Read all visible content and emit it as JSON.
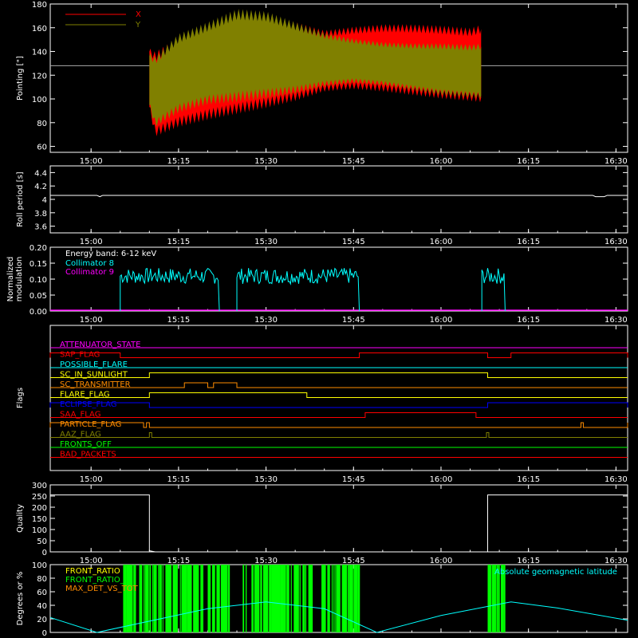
{
  "colors": {
    "background": "#000000",
    "axes": "#ffffff",
    "x_series": "#ff0000",
    "y_series": "#808000",
    "collimator8": "#00ffff",
    "collimator9": "#ff00ff",
    "green": "#00ff00",
    "orange": "#ff8c00",
    "cyan": "#00ffff"
  },
  "chart_data": [
    {
      "type": "area",
      "id": "pointing",
      "ylabel": "Pointing [\"]",
      "ylim": [
        55,
        180
      ],
      "yticks": [
        60,
        80,
        100,
        120,
        140,
        160,
        180
      ],
      "xlim": [
        "14:53",
        "16:32"
      ],
      "xticks": [
        "15:00",
        "15:15",
        "15:30",
        "15:45",
        "16:00",
        "16:15",
        "16:30"
      ],
      "reference_line": 128,
      "legend": {
        "position": "top-left",
        "entries": [
          "X",
          "Y"
        ]
      },
      "series": [
        {
          "name": "X",
          "envelope": [
            {
              "t": "15:10",
              "min": 90,
              "max": 143
            },
            {
              "t": "15:11",
              "min": 68,
              "max": 140
            },
            {
              "t": "15:15",
              "min": 76,
              "max": 152
            },
            {
              "t": "15:20",
              "min": 82,
              "max": 162
            },
            {
              "t": "15:25",
              "min": 87,
              "max": 168
            },
            {
              "t": "15:30",
              "min": 92,
              "max": 170
            },
            {
              "t": "15:35",
              "min": 98,
              "max": 165
            },
            {
              "t": "15:40",
              "min": 106,
              "max": 158
            },
            {
              "t": "15:45",
              "min": 108,
              "max": 161
            },
            {
              "t": "15:50",
              "min": 106,
              "max": 163
            },
            {
              "t": "15:55",
              "min": 103,
              "max": 163
            },
            {
              "t": "16:00",
              "min": 100,
              "max": 162
            },
            {
              "t": "16:05",
              "min": 98,
              "max": 160
            },
            {
              "t": "16:07",
              "min": 97,
              "max": 163
            }
          ]
        },
        {
          "name": "Y",
          "envelope": [
            {
              "t": "15:10",
              "min": 92,
              "max": 139
            },
            {
              "t": "15:11",
              "min": 76,
              "max": 136
            },
            {
              "t": "15:15",
              "min": 88,
              "max": 155
            },
            {
              "t": "15:20",
              "min": 95,
              "max": 165
            },
            {
              "t": "15:25",
              "min": 97,
              "max": 176
            },
            {
              "t": "15:30",
              "min": 100,
              "max": 174
            },
            {
              "t": "15:35",
              "min": 104,
              "max": 165
            },
            {
              "t": "15:40",
              "min": 110,
              "max": 156
            },
            {
              "t": "15:45",
              "min": 113,
              "max": 151
            },
            {
              "t": "15:50",
              "min": 111,
              "max": 148
            },
            {
              "t": "15:55",
              "min": 107,
              "max": 147
            },
            {
              "t": "16:00",
              "min": 103,
              "max": 147
            },
            {
              "t": "16:05",
              "min": 101,
              "max": 146
            },
            {
              "t": "16:07",
              "min": 100,
              "max": 147
            }
          ]
        }
      ]
    },
    {
      "type": "line",
      "id": "roll",
      "ylabel": "Roll period [s]",
      "ylim": [
        3.5,
        4.5
      ],
      "yticks": [
        3.6,
        3.8,
        4.0,
        4.2,
        4.4
      ],
      "xticks": [
        "15:00",
        "15:15",
        "15:30",
        "15:45",
        "16:00",
        "16:15",
        "16:30"
      ],
      "series": [
        {
          "name": "",
          "points": [
            {
              "t": "14:53",
              "v": 4.06
            },
            {
              "t": "15:01",
              "v": 4.06
            },
            {
              "t": "15:01.5",
              "v": 4.04
            },
            {
              "t": "15:02",
              "v": 4.06
            },
            {
              "t": "16:26",
              "v": 4.06
            },
            {
              "t": "16:26.5",
              "v": 4.04
            },
            {
              "t": "16:28",
              "v": 4.04
            },
            {
              "t": "16:28.5",
              "v": 4.06
            },
            {
              "t": "16:32",
              "v": 4.06
            }
          ]
        }
      ]
    },
    {
      "type": "line",
      "id": "modulation",
      "ylabel": "Normalized modulation",
      "ylim": [
        0.0,
        0.2
      ],
      "yticks": [
        "0.00",
        "0.05",
        "0.10",
        "0.15",
        "0.20"
      ],
      "xticks": [
        "15:00",
        "15:15",
        "15:30",
        "15:45",
        "16:00",
        "16:15",
        "16:30"
      ],
      "annotation": "Energy band: 6-12 keV",
      "legend": {
        "position": "top-left",
        "entries": [
          "Collimator 8",
          "Collimator 9"
        ]
      },
      "series": [
        {
          "name": "Collimator 8",
          "segments": [
            {
              "start": "15:05",
              "end": "15:22",
              "mean": 0.11
            },
            {
              "start": "15:25",
              "end": "15:46",
              "mean": 0.11
            },
            {
              "start": "16:07",
              "end": "16:11",
              "mean": 0.11
            }
          ]
        },
        {
          "name": "Collimator 9",
          "constant": 0.0
        }
      ]
    },
    {
      "type": "table",
      "id": "flags",
      "ylabel": "Flags",
      "xticks": [
        "15:00",
        "15:15",
        "15:30",
        "15:45",
        "16:00",
        "16:15",
        "16:30"
      ],
      "rows": [
        {
          "name": "ATTENUATOR_STATE",
          "color": "#ff00ff",
          "high": []
        },
        {
          "name": "SAP_FLAG",
          "color": "#ff0000",
          "high": [
            [
              "14:53",
              "15:05"
            ],
            [
              "15:46",
              "16:08"
            ],
            [
              "16:12",
              "16:32"
            ]
          ]
        },
        {
          "name": "POSSIBLE_FLARE",
          "color": "#00ffff",
          "high": []
        },
        {
          "name": "SC_IN_SUNLIGHT",
          "color": "#ffff00",
          "high": [
            [
              "15:10",
              "16:08"
            ]
          ]
        },
        {
          "name": "SC_TRANSMITTER",
          "color": "#ff8c00",
          "high": [
            [
              "15:16",
              "15:20"
            ],
            [
              "15:21",
              "15:25"
            ]
          ]
        },
        {
          "name": "FLARE_FLAG",
          "color": "#ffff00",
          "high": [
            [
              "15:10",
              "15:37"
            ]
          ]
        },
        {
          "name": "ECLIPSE_FLAG",
          "color": "#0000ff",
          "high": [
            [
              "14:53",
              "15:10"
            ],
            [
              "16:08",
              "16:32"
            ]
          ]
        },
        {
          "name": "SAA_FLAG",
          "color": "#ff0000",
          "high": [
            [
              "15:47",
              "16:06"
            ]
          ]
        },
        {
          "name": "PARTICLE_FLAG",
          "color": "#ff8c00",
          "high": [
            [
              "14:53",
              "15:09"
            ],
            [
              "15:09.5",
              "15:10"
            ],
            [
              "16:24",
              "16:24.4"
            ],
            [
              "16:32",
              "16:32"
            ]
          ]
        },
        {
          "name": "AAZ_FLAG",
          "color": "#808000",
          "high": [
            [
              "15:10",
              "15:10.4"
            ],
            [
              "16:07.8",
              "16:08.2"
            ]
          ]
        },
        {
          "name": "FRONTS_OFF",
          "color": "#00ff00",
          "high": []
        },
        {
          "name": "BAD_PACKETS",
          "color": "#ff0000",
          "high": []
        }
      ]
    },
    {
      "type": "line",
      "id": "quality",
      "ylabel": "Quality",
      "ylim": [
        0,
        300
      ],
      "yticks": [
        0,
        50,
        100,
        150,
        200,
        250,
        300
      ],
      "xticks": [
        "15:00",
        "15:15",
        "15:30",
        "15:45",
        "16:00",
        "16:15",
        "16:30"
      ],
      "series": [
        {
          "name": "",
          "points": [
            {
              "t": "14:53",
              "v": 255
            },
            {
              "t": "15:10",
              "v": 255
            },
            {
              "t": "15:10",
              "v": 5
            },
            {
              "t": "15:11",
              "v": 0
            },
            {
              "t": "16:08",
              "v": 0
            },
            {
              "t": "16:08",
              "v": 255
            },
            {
              "t": "16:32",
              "v": 255
            }
          ]
        }
      ]
    },
    {
      "type": "bar",
      "id": "degrees",
      "ylabel": "Degrees or %",
      "ylim": [
        0,
        100
      ],
      "yticks": [
        0,
        20,
        40,
        60,
        80,
        100
      ],
      "xticks": [
        "15:00",
        "15:15",
        "15:30",
        "15:45",
        "16:00",
        "16:15",
        "16:30"
      ],
      "legend": {
        "position": "top-left",
        "entries": [
          "FRONT_RATIO",
          "FRONT_RATIO_",
          "MAX_DET_VS_TOT"
        ]
      },
      "right_label": "Absolute geomagnetic latitude",
      "bars": {
        "series": "FRONT_RATIO_",
        "ranges": [
          [
            "15:05",
            "15:46"
          ],
          [
            "16:07",
            "16:11"
          ]
        ]
      },
      "series": [
        {
          "name": "Absolute geomagnetic latitude",
          "points": [
            {
              "t": "14:53",
              "v": 22
            },
            {
              "t": "15:01",
              "v": 0
            },
            {
              "t": "15:20",
              "v": 35
            },
            {
              "t": "15:30",
              "v": 45
            },
            {
              "t": "15:40",
              "v": 35
            },
            {
              "t": "15:49",
              "v": 0
            },
            {
              "t": "16:00",
              "v": 25
            },
            {
              "t": "16:12",
              "v": 45
            },
            {
              "t": "16:20",
              "v": 36
            },
            {
              "t": "16:32",
              "v": 18
            }
          ]
        }
      ]
    }
  ]
}
